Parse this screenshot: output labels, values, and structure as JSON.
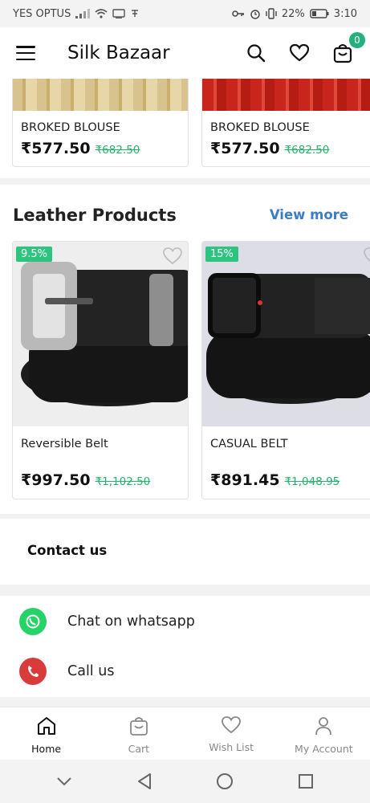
{
  "status_bar": {
    "carrier": "YES OPTUS",
    "battery": "22%",
    "time": "3:10"
  },
  "header": {
    "title": "Silk Bazaar",
    "cart_count": "0"
  },
  "top_products": [
    {
      "name": "BROKED BLOUSE",
      "price": "₹577.50",
      "old_price": "₹682.50"
    },
    {
      "name": "BROKED BLOUSE",
      "price": "₹577.50",
      "old_price": "₹682.50"
    }
  ],
  "leather_section": {
    "title": "Leather Products",
    "view_more": "View more",
    "products": [
      {
        "name": "Reversible Belt",
        "price": "₹997.50",
        "old_price": "₹1,102.50",
        "discount": "9.5%"
      },
      {
        "name": "CASUAL BELT",
        "price": "₹891.45",
        "old_price": "₹1,048.95",
        "discount": "15%"
      }
    ]
  },
  "contact": {
    "title": "Contact us",
    "whatsapp_label": "Chat on whatsapp",
    "call_label": "Call us"
  },
  "bottom_nav": {
    "items": [
      {
        "label": "Home",
        "icon": "home-icon",
        "active": true
      },
      {
        "label": "Cart",
        "icon": "cart-icon",
        "active": false
      },
      {
        "label": "Wish List",
        "icon": "heart-icon",
        "active": false
      },
      {
        "label": "My Account",
        "icon": "user-icon",
        "active": false
      }
    ]
  },
  "colors": {
    "accent_green": "#22b07d",
    "link_blue": "#3a7dc9",
    "strike_green": "#28b36c",
    "whatsapp_green": "#25d366",
    "call_red": "#d93b3b"
  }
}
